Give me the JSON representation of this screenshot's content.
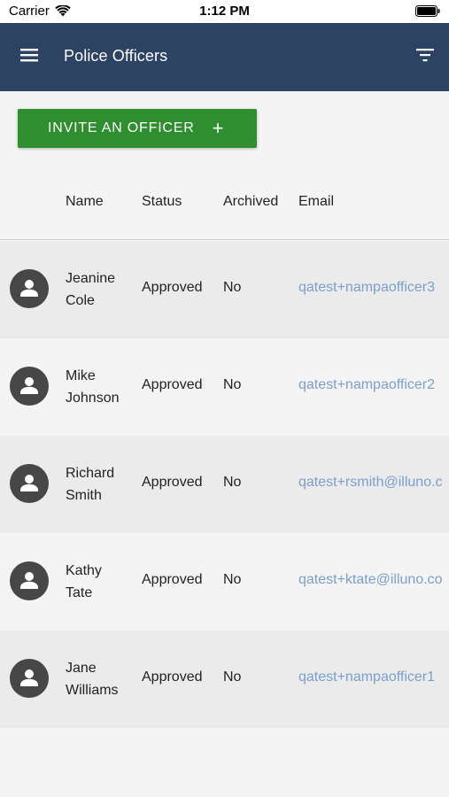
{
  "status_bar": {
    "carrier": "Carrier",
    "time": "1:12 PM"
  },
  "app_bar": {
    "title": "Police Officers"
  },
  "invite_button": {
    "label": "INVITE AN OFFICER",
    "plus": "+"
  },
  "table": {
    "headers": {
      "name": "Name",
      "status": "Status",
      "archived": "Archived",
      "email": "Email"
    },
    "rows": [
      {
        "first": "Jeanine",
        "last": "Cole",
        "status": "Approved",
        "archived": "No",
        "email": "qatest+nampaofficer3"
      },
      {
        "first": "Mike",
        "last": "Johnson",
        "status": "Approved",
        "archived": "No",
        "email": "qatest+nampaofficer2"
      },
      {
        "first": "Richard",
        "last": "Smith",
        "status": "Approved",
        "archived": "No",
        "email": "qatest+rsmith@illuno.c"
      },
      {
        "first": "Kathy",
        "last": "Tate",
        "status": "Approved",
        "archived": "No",
        "email": "qatest+ktate@illuno.co"
      },
      {
        "first": "Jane",
        "last": "Williams",
        "status": "Approved",
        "archived": "No",
        "email": "qatest+nampaofficer1"
      }
    ]
  },
  "colors": {
    "app_bar": "#2c4364",
    "invite_button": "#2f8f2f",
    "email_link": "#7b9fcc",
    "avatar": "#474747"
  },
  "icons": {
    "menu": "hamburger-menu-icon",
    "filter": "filter-icon",
    "avatar": "person-icon",
    "wifi": "wifi-icon",
    "battery": "battery-icon"
  }
}
